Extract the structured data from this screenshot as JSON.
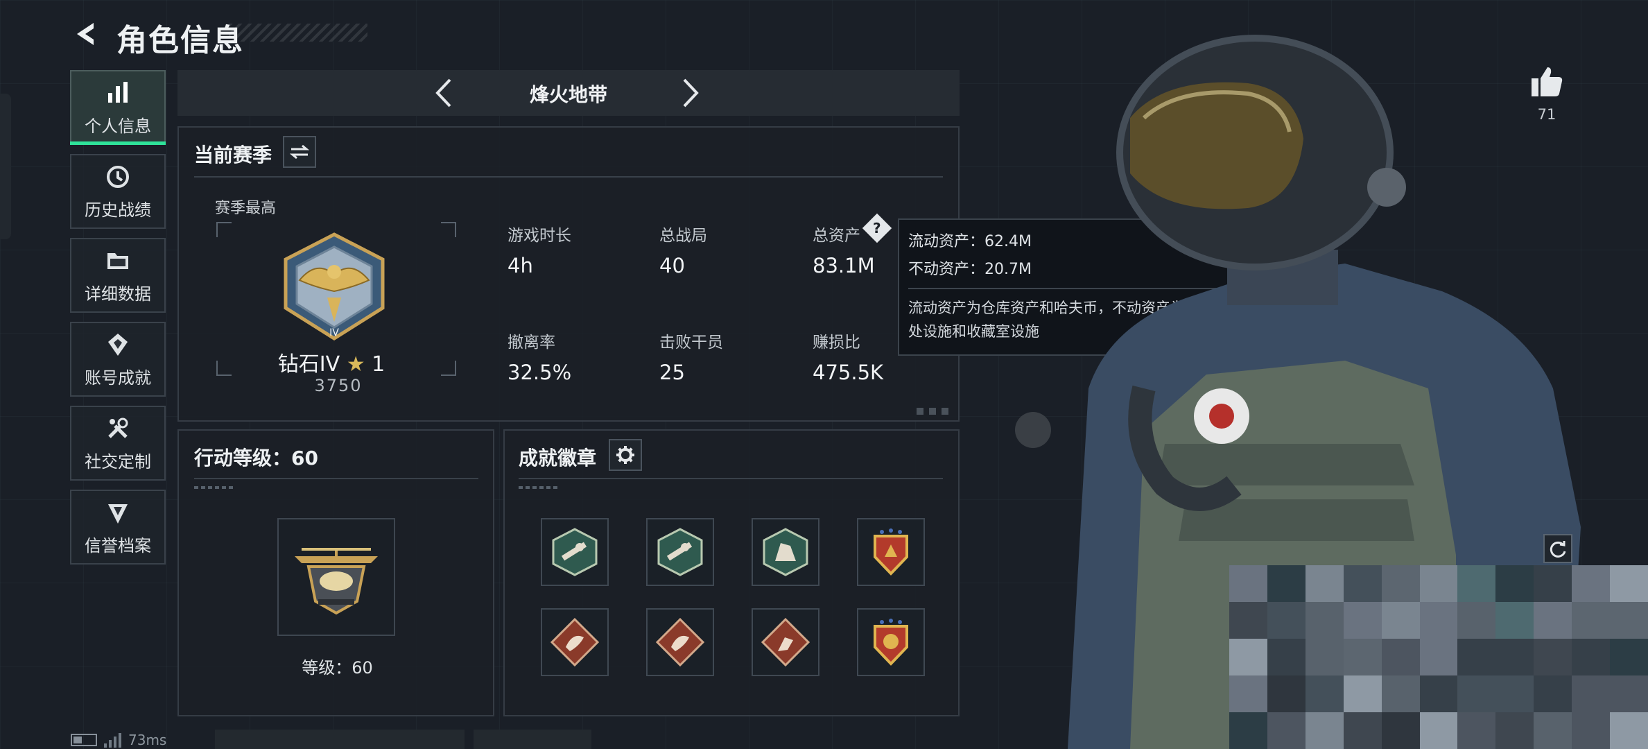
{
  "header": {
    "title": "角色信息"
  },
  "nav": {
    "items": [
      {
        "label": "个人信息",
        "icon": "bar-chart-icon",
        "active": true
      },
      {
        "label": "历史战绩",
        "icon": "history-clock-icon",
        "active": false
      },
      {
        "label": "详细数据",
        "icon": "folder-icon",
        "active": false
      },
      {
        "label": "账号成就",
        "icon": "achievement-medal-icon",
        "active": false
      },
      {
        "label": "社交定制",
        "icon": "tools-icon",
        "active": false
      },
      {
        "label": "信誉档案",
        "icon": "shield-emblem-icon",
        "active": false
      }
    ]
  },
  "mode": {
    "name": "烽火地带"
  },
  "season": {
    "title": "当前赛季",
    "best_label": "赛季最高",
    "rank_name": "钻石IV",
    "rank_stars": "1",
    "rank_score": "3750",
    "stats": [
      {
        "label": "游戏时长",
        "value": "4h"
      },
      {
        "label": "总战局",
        "value": "40"
      },
      {
        "label": "总资产",
        "value": "83.1M"
      },
      {
        "label": "撤离率",
        "value": "32.5%"
      },
      {
        "label": "击败干员",
        "value": "25"
      },
      {
        "label": "赚损比",
        "value": "475.5K"
      }
    ]
  },
  "tooltip": {
    "liquid": "流动资产：62.4M",
    "fixed": "不动资产：20.7M",
    "desc": "流动资产为仓库资产和哈夫币，不动资产为特勤处设施和收藏室设施"
  },
  "level": {
    "title": "行动等级：60",
    "label": "等级：60"
  },
  "achievements": {
    "title": "成就徽章"
  },
  "likes": {
    "count": "71"
  },
  "status": {
    "ping": "73ms"
  },
  "colors": {
    "accent": "#2fe39a",
    "panel_bg": "#1b2027"
  }
}
